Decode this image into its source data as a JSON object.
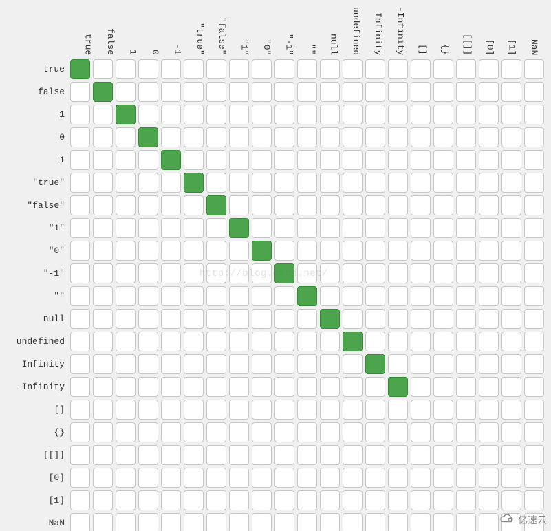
{
  "chart_data": {
    "type": "heatmap",
    "title": "",
    "categories": [
      "true",
      "false",
      "1",
      "0",
      "-1",
      "\"true\"",
      "\"false\"",
      "\"1\"",
      "\"0\"",
      "\"-1\"",
      "\"\"",
      "null",
      "undefined",
      "Infinity",
      "-Infinity",
      "[]",
      "{}",
      "[[]]",
      "[0]",
      "[1]",
      "NaN"
    ],
    "values": [
      {
        "row": "true",
        "col": "true",
        "v": 1
      },
      {
        "row": "false",
        "col": "false",
        "v": 1
      },
      {
        "row": "1",
        "col": "1",
        "v": 1
      },
      {
        "row": "0",
        "col": "0",
        "v": 1
      },
      {
        "row": "-1",
        "col": "-1",
        "v": 1
      },
      {
        "row": "\"true\"",
        "col": "\"true\"",
        "v": 1
      },
      {
        "row": "\"false\"",
        "col": "\"false\"",
        "v": 1
      },
      {
        "row": "\"1\"",
        "col": "\"1\"",
        "v": 1
      },
      {
        "row": "\"0\"",
        "col": "\"0\"",
        "v": 1
      },
      {
        "row": "\"-1\"",
        "col": "\"-1\"",
        "v": 1
      },
      {
        "row": "\"\"",
        "col": "\"\"",
        "v": 1
      },
      {
        "row": "null",
        "col": "null",
        "v": 1
      },
      {
        "row": "undefined",
        "col": "undefined",
        "v": 1
      },
      {
        "row": "Infinity",
        "col": "Infinity",
        "v": 1
      },
      {
        "row": "-Infinity",
        "col": "-Infinity",
        "v": 1
      }
    ],
    "legend": {
      "1": "green",
      "0": "white"
    }
  },
  "watermark": {
    "text": "亿速云"
  },
  "blog_watermark": "http://blog.csdn.net/"
}
